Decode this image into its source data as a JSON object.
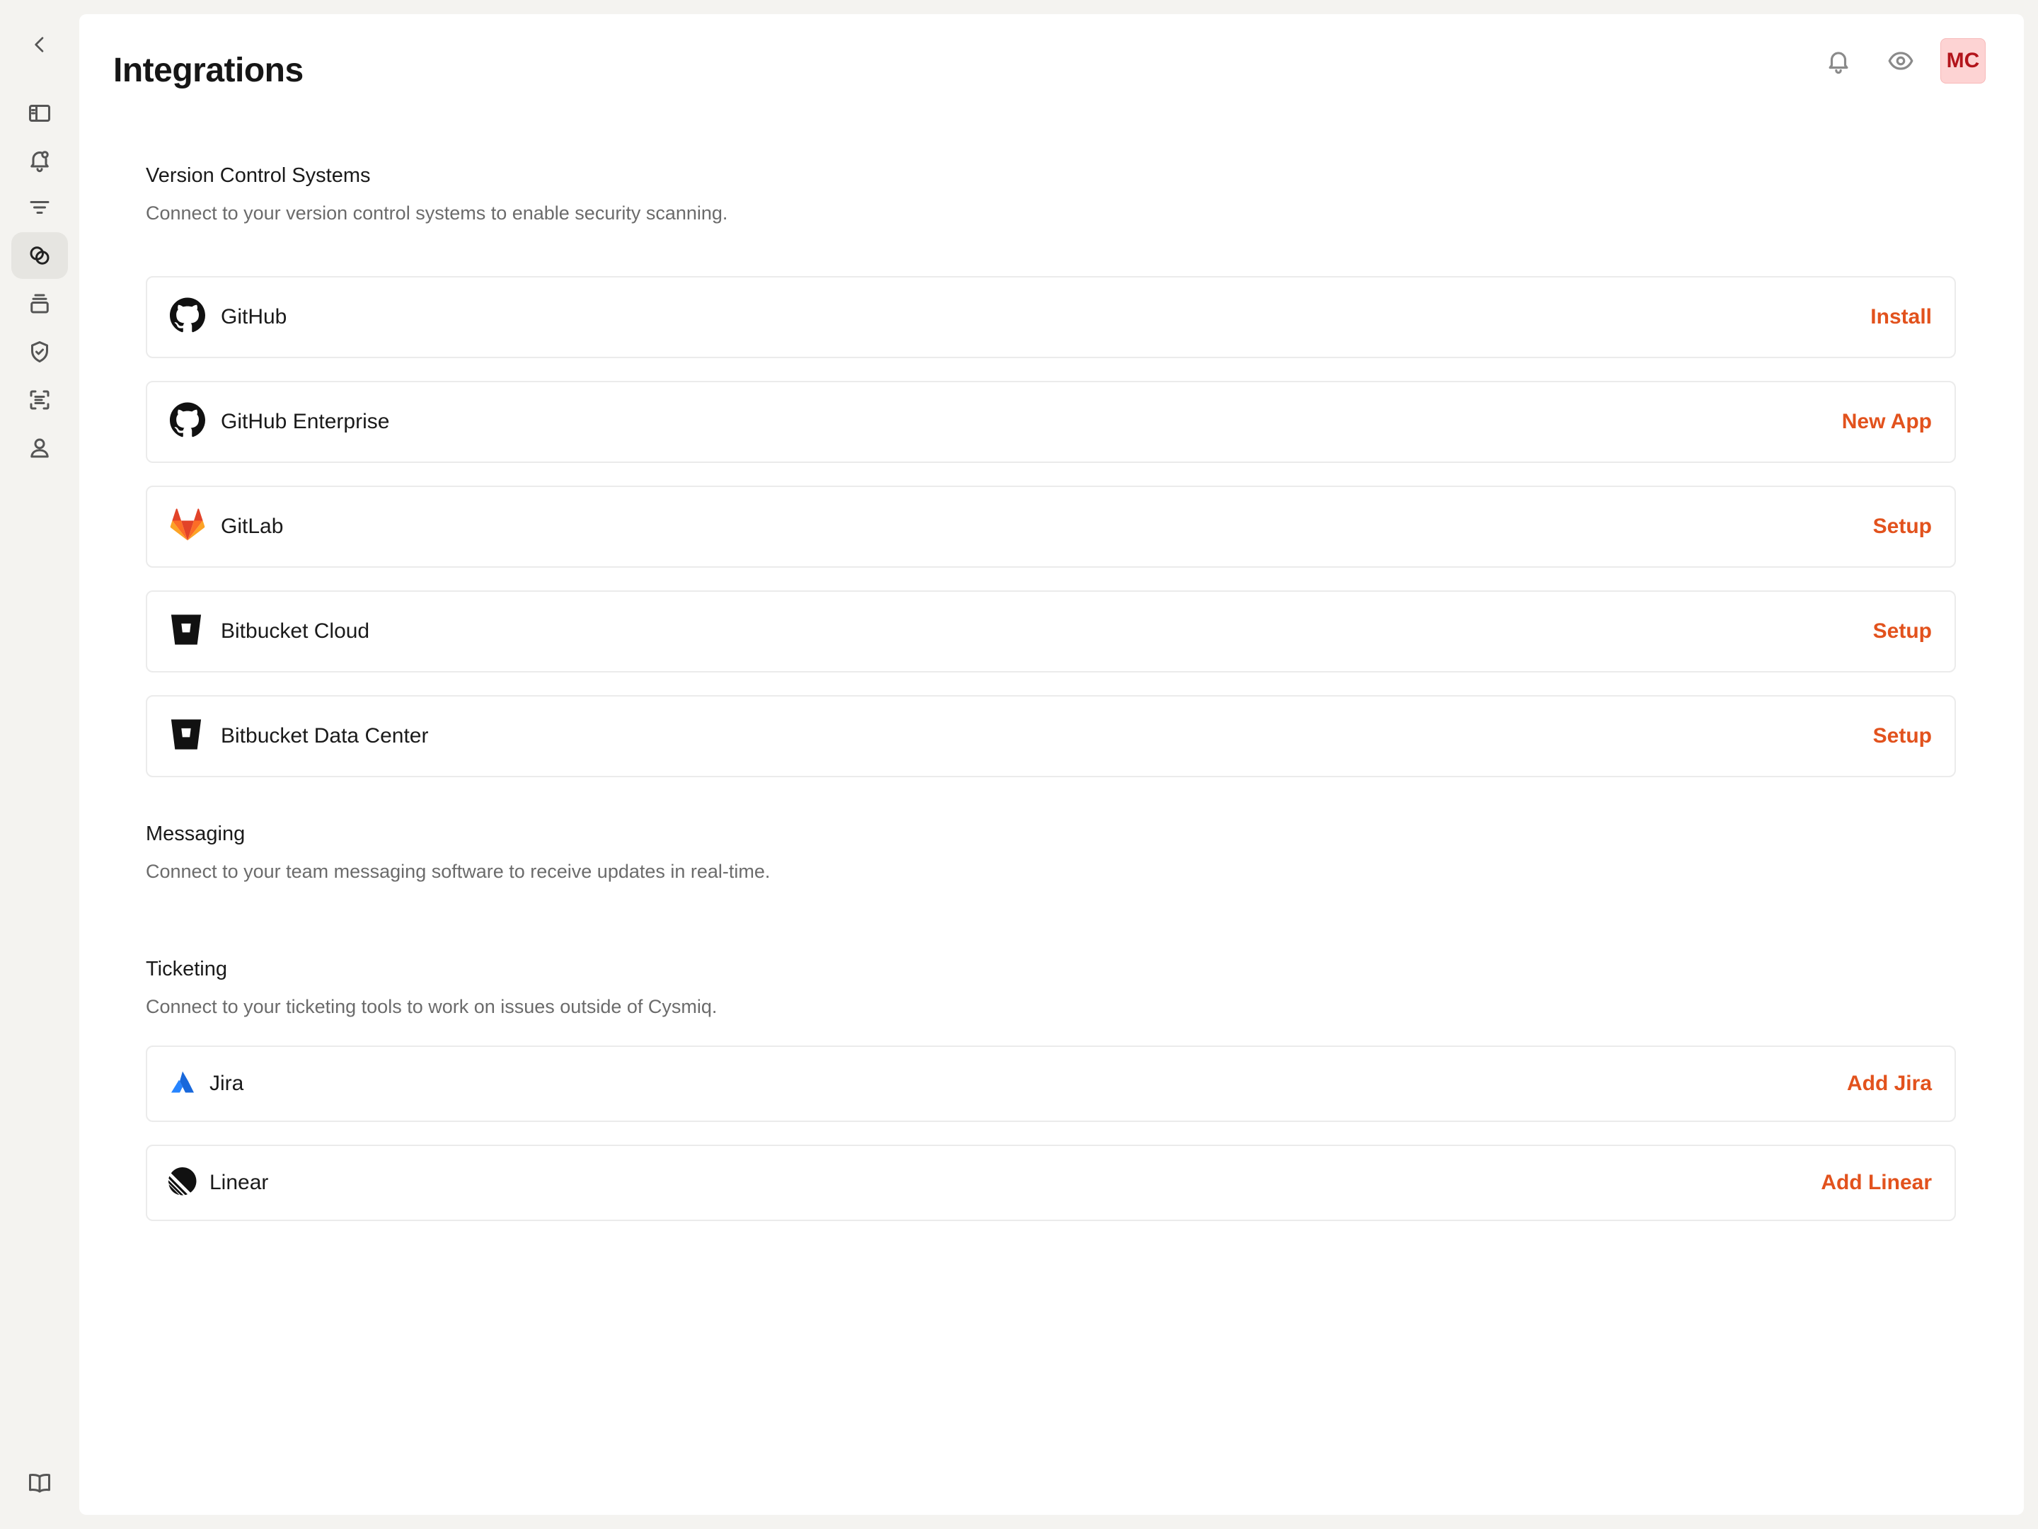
{
  "page": {
    "title": "Integrations"
  },
  "header": {
    "avatar_initials": "MC"
  },
  "sections": [
    {
      "title": "Version Control Systems",
      "description": "Connect to your version control systems to enable security scanning.",
      "items": [
        {
          "name": "GitHub",
          "action": "Install",
          "icon": "github-icon"
        },
        {
          "name": "GitHub Enterprise",
          "action": "New App",
          "icon": "github-icon"
        },
        {
          "name": "GitLab",
          "action": "Setup",
          "icon": "gitlab-icon"
        },
        {
          "name": "Bitbucket Cloud",
          "action": "Setup",
          "icon": "bitbucket-icon"
        },
        {
          "name": "Bitbucket Data Center",
          "action": "Setup",
          "icon": "bitbucket-icon"
        }
      ]
    },
    {
      "title": "Messaging",
      "description": "Connect to your team messaging software to receive updates in real-time.",
      "items": []
    },
    {
      "title": "Ticketing",
      "description": "Connect to your ticketing tools to work on issues outside of Cysmiq.",
      "items": [
        {
          "name": "Jira",
          "action": "Add Jira",
          "icon": "jira-icon"
        },
        {
          "name": "Linear",
          "action": "Add Linear",
          "icon": "linear-icon"
        }
      ]
    }
  ],
  "colors": {
    "accent": "#e2521d",
    "avatar_bg": "#fdd3d3",
    "avatar_text": "#b3141b",
    "page_bg": "#f4f3f0"
  }
}
